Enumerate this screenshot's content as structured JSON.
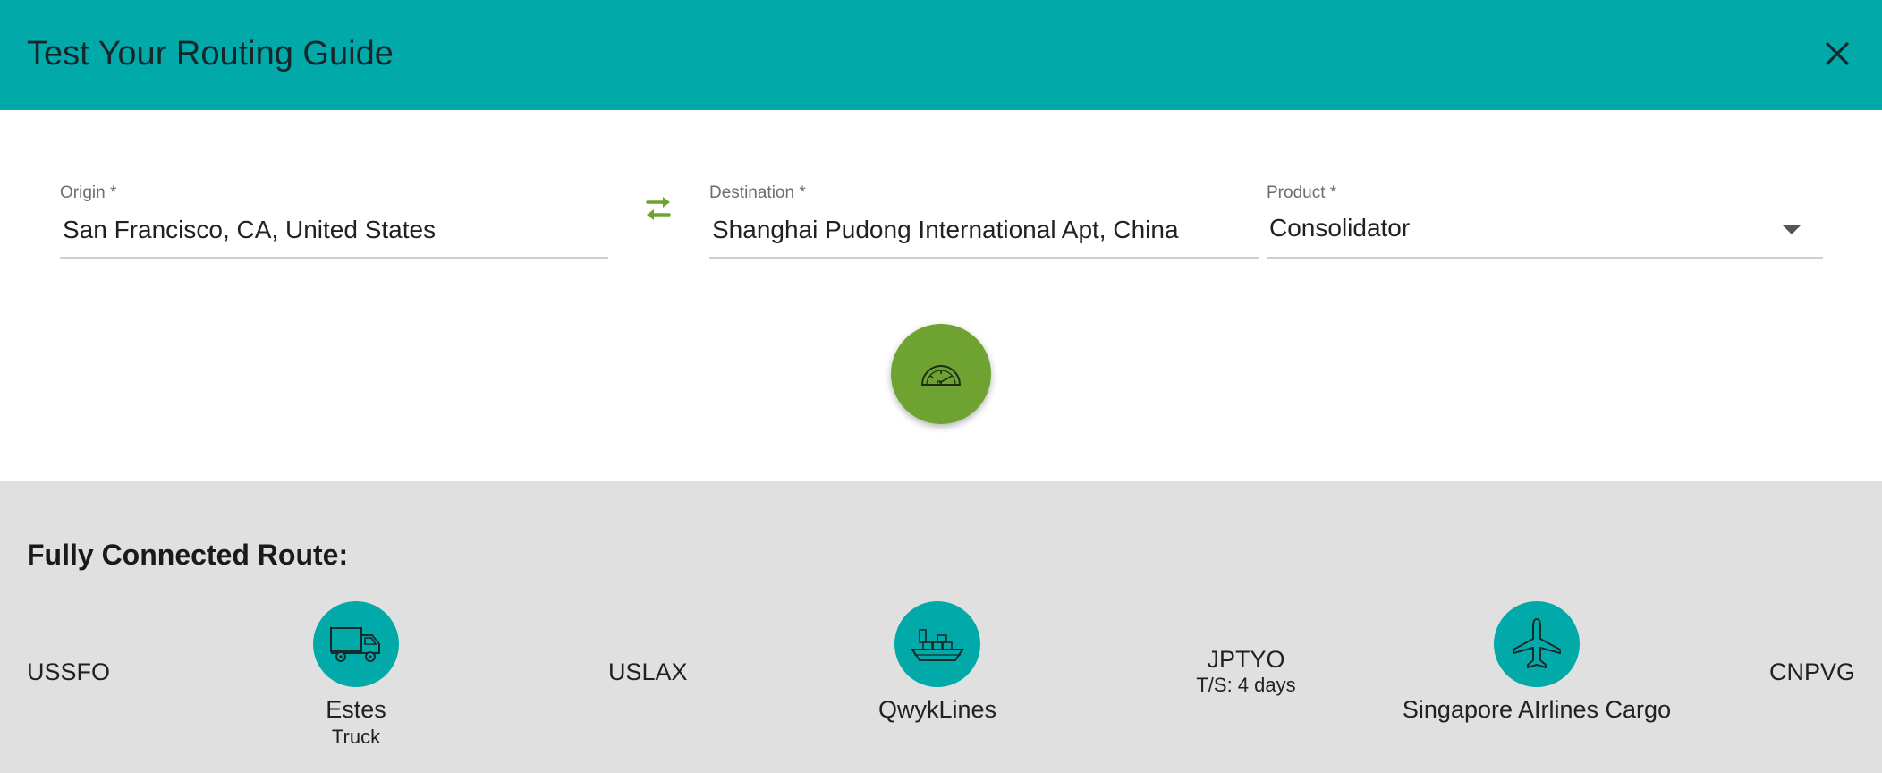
{
  "dialog": {
    "title": "Test Your Routing Guide"
  },
  "form": {
    "origin": {
      "label": "Origin *",
      "value": "San Francisco, CA, United States"
    },
    "destination": {
      "label": "Destination *",
      "value": "Shanghai Pudong International Apt, China"
    },
    "product": {
      "label": "Product *",
      "value": "Consolidator"
    }
  },
  "route": {
    "title": "Fully Connected Route:",
    "nodes": [
      "USSFO",
      "USLAX",
      "JPTYO",
      "CNPVG"
    ],
    "transit_time": "T/S: 4 days",
    "legs": [
      {
        "carrier": "Estes",
        "mode": "Truck",
        "icon": "truck-icon"
      },
      {
        "carrier": "QwykLines",
        "mode": "",
        "icon": "ship-icon"
      },
      {
        "carrier": "Singapore AIrlines Cargo",
        "mode": "",
        "icon": "airplane-icon"
      }
    ]
  },
  "colors": {
    "header": "#02a9a9",
    "accent_green": "#6ea331",
    "route_background": "#e0e0e0",
    "icon_circle": "#02a9a9"
  }
}
